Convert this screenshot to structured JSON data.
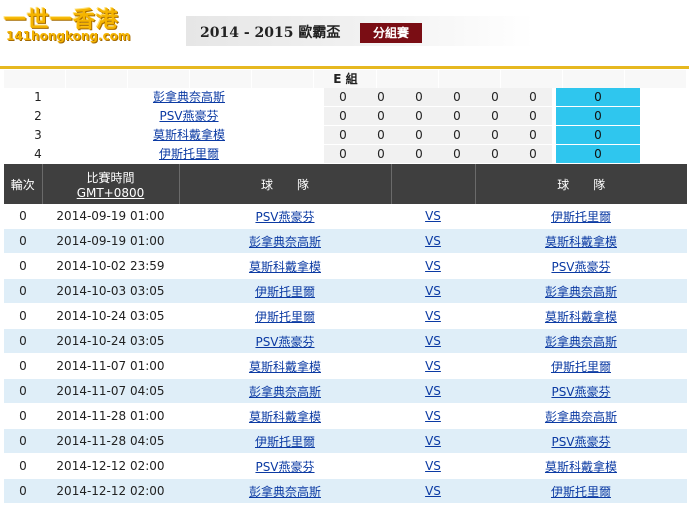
{
  "logo": {
    "line1": "一世一香港",
    "line2": "141hongkong.com"
  },
  "header": {
    "title": "2014 - 2015 歐霸盃",
    "group_button": "分組賽"
  },
  "group": {
    "label": "E 組"
  },
  "standings": [
    {
      "rank": "1",
      "team": "彭拿典奈高斯",
      "stats": [
        "0",
        "0",
        "0",
        "0",
        "0",
        "0"
      ],
      "points": "0"
    },
    {
      "rank": "2",
      "team": "PSV燕豪芬",
      "stats": [
        "0",
        "0",
        "0",
        "0",
        "0",
        "0"
      ],
      "points": "0"
    },
    {
      "rank": "3",
      "team": "莫斯科戴拿模",
      "stats": [
        "0",
        "0",
        "0",
        "0",
        "0",
        "0"
      ],
      "points": "0"
    },
    {
      "rank": "4",
      "team": "伊斯托里爾",
      "stats": [
        "0",
        "0",
        "0",
        "0",
        "0",
        "0"
      ],
      "points": "0"
    }
  ],
  "fixtures_header": {
    "round": "輪次",
    "time_line1": "比賽時間",
    "time_line2": "GMT+0800",
    "team_home": "球　　隊",
    "vs": "",
    "team_away": "球　　隊"
  },
  "fixtures": [
    {
      "round": "0",
      "time": "2014-09-19 01:00",
      "home": "PSV燕豪芬",
      "vs": "VS",
      "away": "伊斯托里爾"
    },
    {
      "round": "0",
      "time": "2014-09-19 01:00",
      "home": "彭拿典奈高斯",
      "vs": "VS",
      "away": "莫斯科戴拿模"
    },
    {
      "round": "0",
      "time": "2014-10-02 23:59",
      "home": "莫斯科戴拿模",
      "vs": "VS",
      "away": "PSV燕豪芬"
    },
    {
      "round": "0",
      "time": "2014-10-03 03:05",
      "home": "伊斯托里爾",
      "vs": "VS",
      "away": "彭拿典奈高斯"
    },
    {
      "round": "0",
      "time": "2014-10-24 03:05",
      "home": "伊斯托里爾",
      "vs": "VS",
      "away": "莫斯科戴拿模"
    },
    {
      "round": "0",
      "time": "2014-10-24 03:05",
      "home": "PSV燕豪芬",
      "vs": "VS",
      "away": "彭拿典奈高斯"
    },
    {
      "round": "0",
      "time": "2014-11-07 01:00",
      "home": "莫斯科戴拿模",
      "vs": "VS",
      "away": "伊斯托里爾"
    },
    {
      "round": "0",
      "time": "2014-11-07 04:05",
      "home": "彭拿典奈高斯",
      "vs": "VS",
      "away": "PSV燕豪芬"
    },
    {
      "round": "0",
      "time": "2014-11-28 01:00",
      "home": "莫斯科戴拿模",
      "vs": "VS",
      "away": "彭拿典奈高斯"
    },
    {
      "round": "0",
      "time": "2014-11-28 04:05",
      "home": "伊斯托里爾",
      "vs": "VS",
      "away": "PSV燕豪芬"
    },
    {
      "round": "0",
      "time": "2014-12-12 02:00",
      "home": "PSV燕豪芬",
      "vs": "VS",
      "away": "莫斯科戴拿模"
    },
    {
      "round": "0",
      "time": "2014-12-12 02:00",
      "home": "彭拿典奈高斯",
      "vs": "VS",
      "away": "伊斯托里爾"
    }
  ],
  "colors": {
    "brand_dark_red": "#7a0d14",
    "points_cyan": "#2fc6ee",
    "header_dark": "#3f3f3f",
    "row_alt": "#dfeef8",
    "gold": "#e6b820"
  }
}
